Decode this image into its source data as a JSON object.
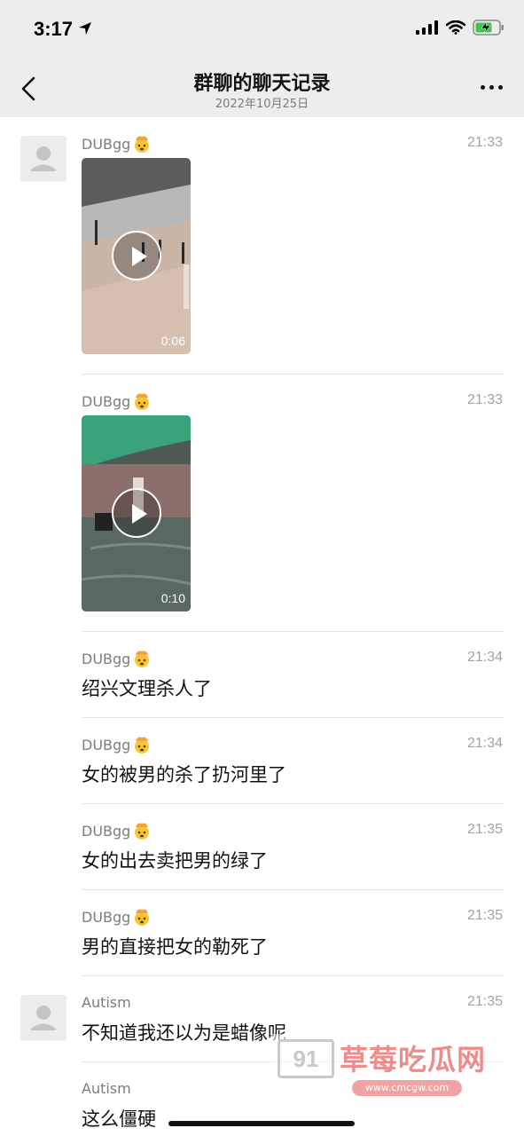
{
  "status_bar": {
    "time": "3:17"
  },
  "header": {
    "title": "群聊的聊天记录",
    "date": "2022年10月25日"
  },
  "messages": [
    {
      "sender": "DUBgg",
      "time": "21:33",
      "type": "video",
      "duration": "0:06"
    },
    {
      "sender": "DUBgg",
      "time": "21:33",
      "type": "video",
      "duration": "0:10"
    },
    {
      "sender": "DUBgg",
      "time": "21:34",
      "type": "text",
      "text": "绍兴文理杀人了"
    },
    {
      "sender": "DUBgg",
      "time": "21:34",
      "type": "text",
      "text": "女的被男的杀了扔河里了"
    },
    {
      "sender": "DUBgg",
      "time": "21:35",
      "type": "text",
      "text": "女的出去卖把男的绿了"
    },
    {
      "sender": "DUBgg",
      "time": "21:35",
      "type": "text",
      "text": "男的直接把女的勒死了"
    },
    {
      "sender": "Autism",
      "time": "21:35",
      "type": "text",
      "text": "不知道我还以为是蜡像呢"
    },
    {
      "sender": "Autism",
      "time": "",
      "type": "text",
      "text": "这么僵硬"
    }
  ],
  "watermark": {
    "logo": "91",
    "title": "草莓吃瓜网",
    "url": "www.cmcgw.com"
  }
}
